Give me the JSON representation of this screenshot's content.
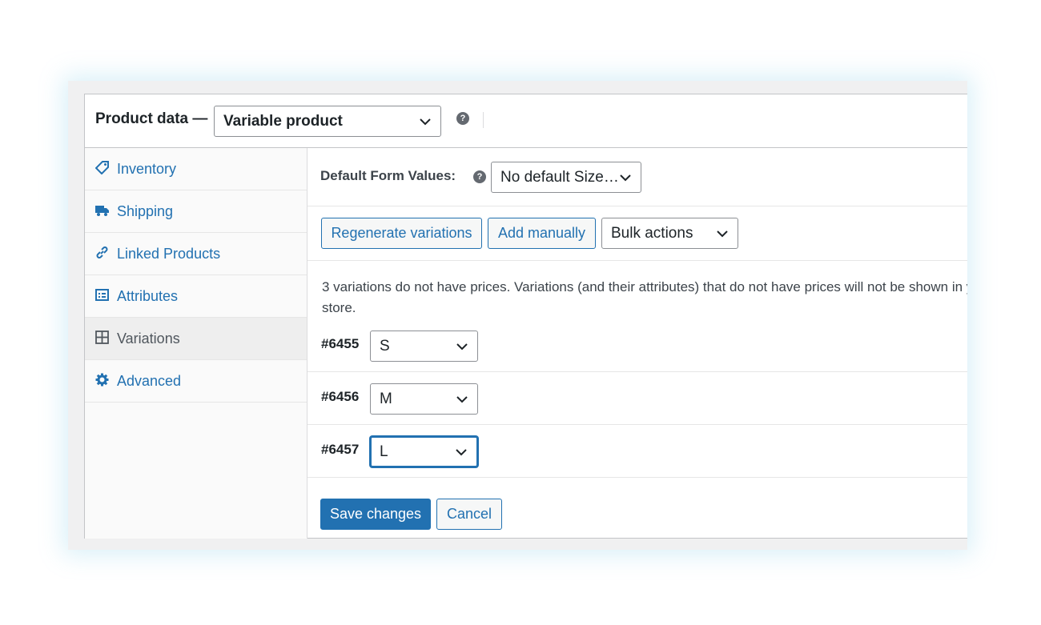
{
  "header": {
    "title": "Product data —",
    "product_type": "Variable product"
  },
  "sidebar": {
    "items": [
      {
        "label": "Inventory",
        "icon": "tag-icon"
      },
      {
        "label": "Shipping",
        "icon": "truck-icon"
      },
      {
        "label": "Linked Products",
        "icon": "link-icon"
      },
      {
        "label": "Attributes",
        "icon": "list-icon"
      },
      {
        "label": "Variations",
        "icon": "grid-icon",
        "active": true
      },
      {
        "label": "Advanced",
        "icon": "gear-icon"
      }
    ]
  },
  "variations": {
    "default_form_label": "Default Form Values:",
    "default_size_value": "No default Size…",
    "regenerate_label": "Regenerate variations",
    "add_manually_label": "Add manually",
    "bulk_actions_value": "Bulk actions",
    "notice_line1": "3 variations do not have prices. Variations (and their attributes) that do not have prices will not be shown in your store.",
    "notice_line2": "store.",
    "rows": [
      {
        "id": "#6455",
        "value": "S"
      },
      {
        "id": "#6456",
        "value": "M"
      },
      {
        "id": "#6457",
        "value": "L"
      }
    ],
    "save_label": "Save changes",
    "cancel_label": "Cancel"
  },
  "colors": {
    "accent": "#2271b1",
    "text": "#1d2327",
    "border": "#c3c4c7"
  }
}
